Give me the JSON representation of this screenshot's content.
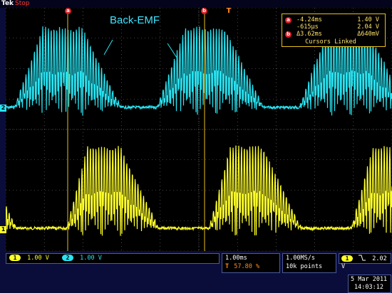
{
  "status": {
    "brand": "Tek",
    "run_state": "Stop"
  },
  "annotation": "Back-EMF",
  "cursor_readout": {
    "a": {
      "badge": "a",
      "time": "-4.24ms",
      "volt": "1.40 V"
    },
    "b": {
      "badge": "b",
      "time": "-615µs",
      "volt": "2.04 V"
    },
    "delta": {
      "badge": "b",
      "time": "Δ3.62ms",
      "volt": "Δ640mV"
    },
    "linked": "Cursors Linked"
  },
  "top_markers": {
    "cursor_a": "a",
    "cursor_b": "b",
    "trigger": "T"
  },
  "channel_markers": {
    "ch1": "1",
    "ch2": "2"
  },
  "channels": {
    "ch1": {
      "num": "1",
      "scale": "1.00 V",
      "color": "#ffff2a"
    },
    "ch2": {
      "num": "2",
      "scale": "1.00 V",
      "color": "#28e4f2"
    }
  },
  "timebase": {
    "scale": "1.00ms",
    "position": "57.80 %",
    "position_icon": "T"
  },
  "acquisition": {
    "rate": "1.00MS/s",
    "record": "10k points"
  },
  "trigger": {
    "source": "1",
    "slope_icon": "falling-edge",
    "level": "2.02 V"
  },
  "datetime": {
    "date": "5 Mar 2011",
    "time": "14:03:12"
  },
  "colors": {
    "ch1": "#ffff2a",
    "ch2": "#28e4f2",
    "cursor": "#e8c01a",
    "badge": "#d8202a",
    "grid": "#7a7a7a"
  }
}
